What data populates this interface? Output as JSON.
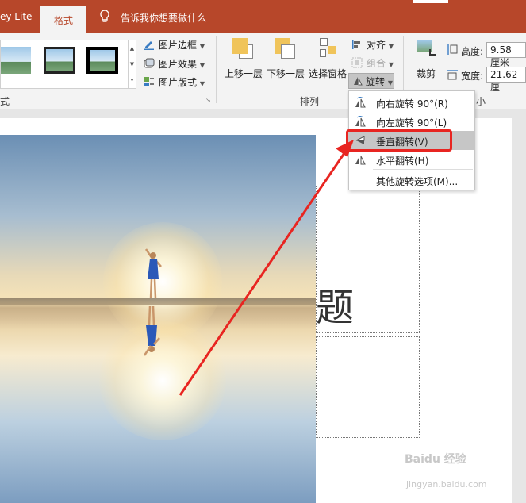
{
  "tabs": {
    "prev_partial": "ey Lite",
    "active": "格式"
  },
  "tell_me": "告诉我你想要做什么",
  "picture_styles": {
    "border": "图片边框",
    "effects": "图片效果",
    "layout": "图片版式",
    "group_label_partial": "式"
  },
  "arrange": {
    "bring_forward": "上移一层",
    "send_backward": "下移一层",
    "selection_pane": "选择窗格",
    "align": "对齐",
    "group": "组合",
    "rotate": "旋转",
    "group_label": "排列"
  },
  "size": {
    "crop": "裁剪",
    "height_label": "高度:",
    "height_value": "9.58 厘米",
    "width_label": "宽度:",
    "width_value": "21.62 厘",
    "group_label_partial": "小"
  },
  "rotate_menu": {
    "items": [
      {
        "label": "向右旋转 90°(R)",
        "icon": "rotate-right-icon"
      },
      {
        "label": "向左旋转 90°(L)",
        "icon": "rotate-left-icon"
      },
      {
        "label": "垂直翻转(V)",
        "icon": "flip-vertical-icon"
      },
      {
        "label": "水平翻转(H)",
        "icon": "flip-horizontal-icon"
      },
      {
        "label": "其他旋转选项(M)..."
      }
    ],
    "highlighted_item": "垂直翻转(V)"
  },
  "slide": {
    "placeholder_char": "题"
  },
  "watermark": {
    "brand": "Baidu 经验",
    "url": "jingyan.baidu.com"
  },
  "colors": {
    "accent": "#b7472a",
    "highlight_red": "#e82521",
    "menu_hover": "#c6c6c6"
  }
}
